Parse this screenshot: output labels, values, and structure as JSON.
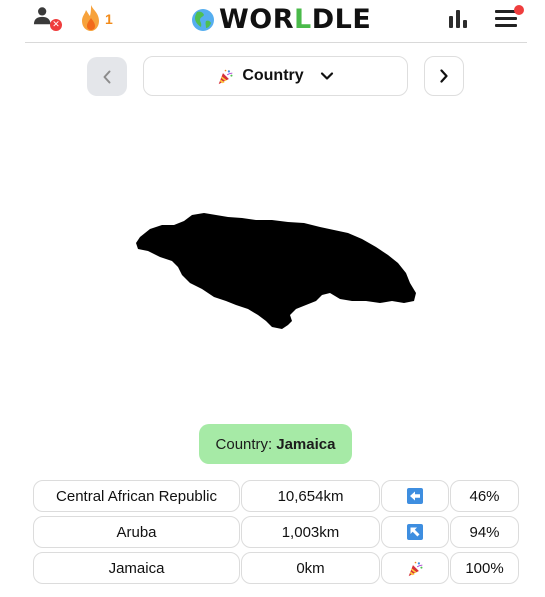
{
  "header": {
    "streak_count": "1",
    "logo_prefix": "WOR",
    "logo_highlight": "L",
    "logo_suffix": "DLE",
    "icons": {
      "user": "user-icon",
      "streak": "flame-icon",
      "stats": "bar-chart-icon",
      "menu": "hamburger-menu-icon"
    }
  },
  "nav": {
    "mode_label": "Country",
    "mode_icon": "party-popper-icon"
  },
  "answer": {
    "prefix": "Country:",
    "value": "Jamaica"
  },
  "guesses": [
    {
      "country": "Central African Republic",
      "distance": "10,654km",
      "direction": "left-arrow-icon",
      "proximity": "46%"
    },
    {
      "country": "Aruba",
      "distance": "1,003km",
      "direction": "up-left-arrow-icon",
      "proximity": "94%"
    },
    {
      "country": "Jamaica",
      "distance": "0km",
      "direction": "party-popper-icon",
      "proximity": "100%"
    }
  ],
  "colors": {
    "accent_green": "#4aba4a",
    "answer_bg": "#a6eaa6",
    "badge_red": "#ef3d3d",
    "streak_orange": "#f28b1b",
    "arrow_blue": "#3e8ee0"
  }
}
